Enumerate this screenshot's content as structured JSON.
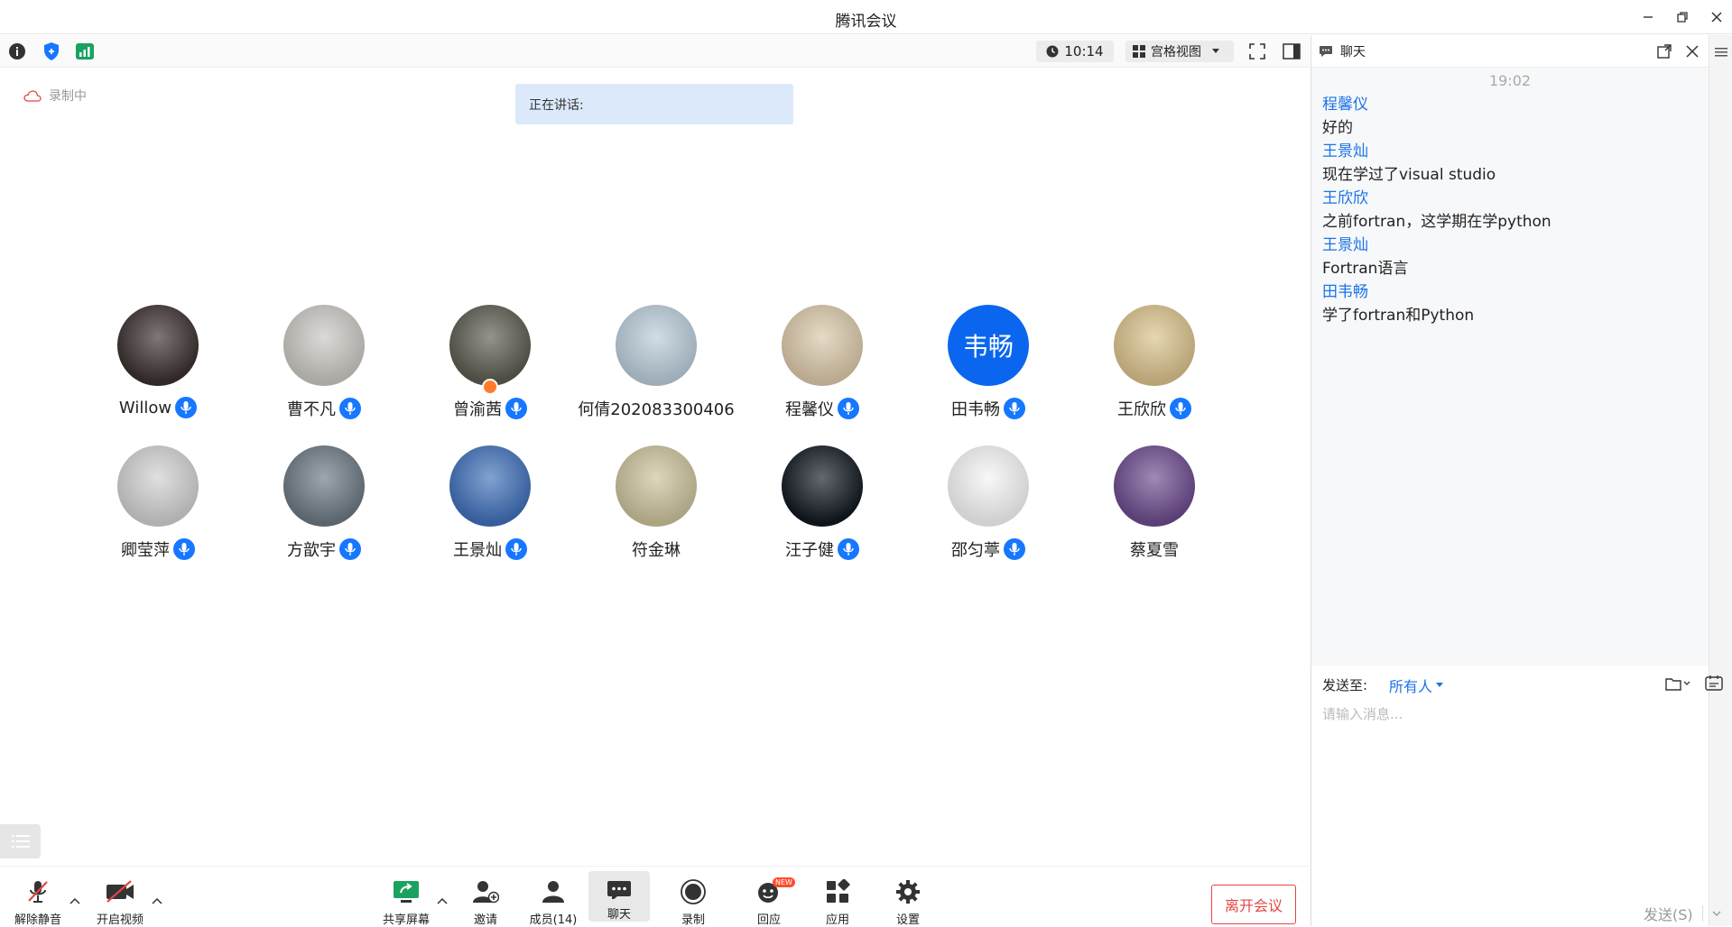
{
  "window": {
    "title": "腾讯会议"
  },
  "toolbar": {
    "timer": "10:14",
    "view_mode": "宫格视图"
  },
  "stage": {
    "recording_label": "录制中",
    "speaking_label": "正在讲话:",
    "participants": [
      {
        "name": "Willow",
        "mic": true,
        "host": false,
        "avatar_color": "#3a2f2f"
      },
      {
        "name": "曹不凡",
        "mic": true,
        "host": false,
        "avatar_color": "#c9c6c1"
      },
      {
        "name": "曾渝茜",
        "mic": true,
        "host": true,
        "avatar_color": "#5a5a4f"
      },
      {
        "name": "何倩202083300406",
        "mic": false,
        "host": false,
        "avatar_color": "#b9cbd8"
      },
      {
        "name": "程馨仪",
        "mic": true,
        "host": false,
        "avatar_color": "#d9c7a8"
      },
      {
        "name": "田韦畅",
        "mic": true,
        "host": false,
        "avatar_color": "#0a66ee",
        "avatar_text": "韦畅"
      },
      {
        "name": "王欣欣",
        "mic": true,
        "host": false,
        "avatar_color": "#d8c08a"
      },
      {
        "name": "卿莹萍",
        "mic": true,
        "host": false,
        "avatar_color": "#cfcfcf"
      },
      {
        "name": "方歆宇",
        "mic": true,
        "host": false,
        "avatar_color": "#6a7781"
      },
      {
        "name": "王景灿",
        "mic": true,
        "host": false,
        "avatar_color": "#3f6fb8"
      },
      {
        "name": "符金琳",
        "mic": false,
        "host": false,
        "avatar_color": "#c9c19a"
      },
      {
        "name": "汪子健",
        "mic": true,
        "host": false,
        "avatar_color": "#111820"
      },
      {
        "name": "邵匀葶",
        "mic": true,
        "host": false,
        "avatar_color": "#f4f4f4"
      },
      {
        "name": "蔡夏雪",
        "mic": false,
        "host": false,
        "avatar_color": "#6b4a8c"
      }
    ]
  },
  "bottombar": {
    "unmute": "解除静音",
    "start_video": "开启视频",
    "share_screen": "共享屏幕",
    "invite": "邀请",
    "members": "成员(14)",
    "chat": "聊天",
    "record": "录制",
    "react": "回应",
    "react_badge": "NEW",
    "apps": "应用",
    "settings": "设置",
    "leave": "离开会议"
  },
  "chat": {
    "title": "聊天",
    "time": "19:02",
    "messages": [
      {
        "sender": "程馨仪",
        "text": "好的"
      },
      {
        "sender": "王景灿",
        "text": "现在学过了visual studio"
      },
      {
        "sender": "王欣欣",
        "text": "之前fortran，这学期在学python"
      },
      {
        "sender": "王景灿",
        "text": "Fortran语言"
      },
      {
        "sender": "田韦畅",
        "text": "学了fortran和Python"
      }
    ],
    "send_to_label": "发送至:",
    "recipient": "所有人",
    "input_placeholder": "请输入消息...",
    "send_label": "发送(S)"
  },
  "colors": {
    "accent": "#1677ff",
    "leave": "#e54545",
    "sender": "#1a73e8"
  }
}
